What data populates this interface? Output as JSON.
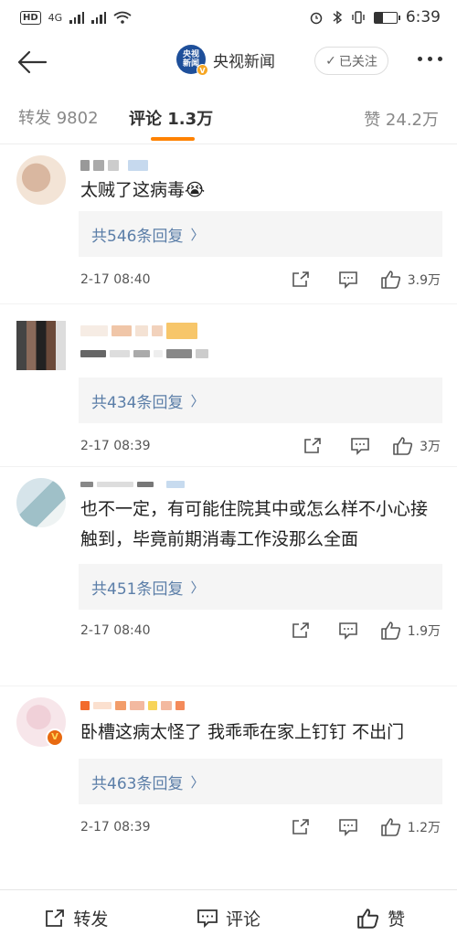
{
  "status_bar": {
    "network": "HD",
    "signal_label": "4G",
    "time": "6:39"
  },
  "nav": {
    "channel_name": "央视新闻",
    "logo_text": "央视新闻",
    "follow_label": "已关注"
  },
  "tabs": {
    "repost": "转发 9802",
    "comments": "评论 1.3万",
    "likes": "赞 24.2万"
  },
  "comments": [
    {
      "text": "太贼了这病毒😭",
      "replies": "共546条回复",
      "time": "2-17 08:40",
      "likes": "3.9万"
    },
    {
      "text": "",
      "replies": "共434条回复",
      "time": "2-17 08:39",
      "likes": "3万"
    },
    {
      "text": "也不一定，有可能住院其中或怎么样不小心接触到，毕竟前期消毒工作没那么全面",
      "replies": "共451条回复",
      "time": "2-17 08:40",
      "likes": "1.9万"
    },
    {
      "text": "卧槽这病太怪了 我乖乖在家上钉钉 不出门",
      "replies": "共463条回复",
      "time": "2-17 08:39",
      "likes": "1.2万"
    }
  ],
  "bottom_bar": {
    "repost": "转发",
    "comment": "评论",
    "like": "赞"
  },
  "colors": {
    "accent": "#ff8200",
    "reply_link": "#5b7ea8",
    "logo_blue": "#1e4f9a"
  }
}
